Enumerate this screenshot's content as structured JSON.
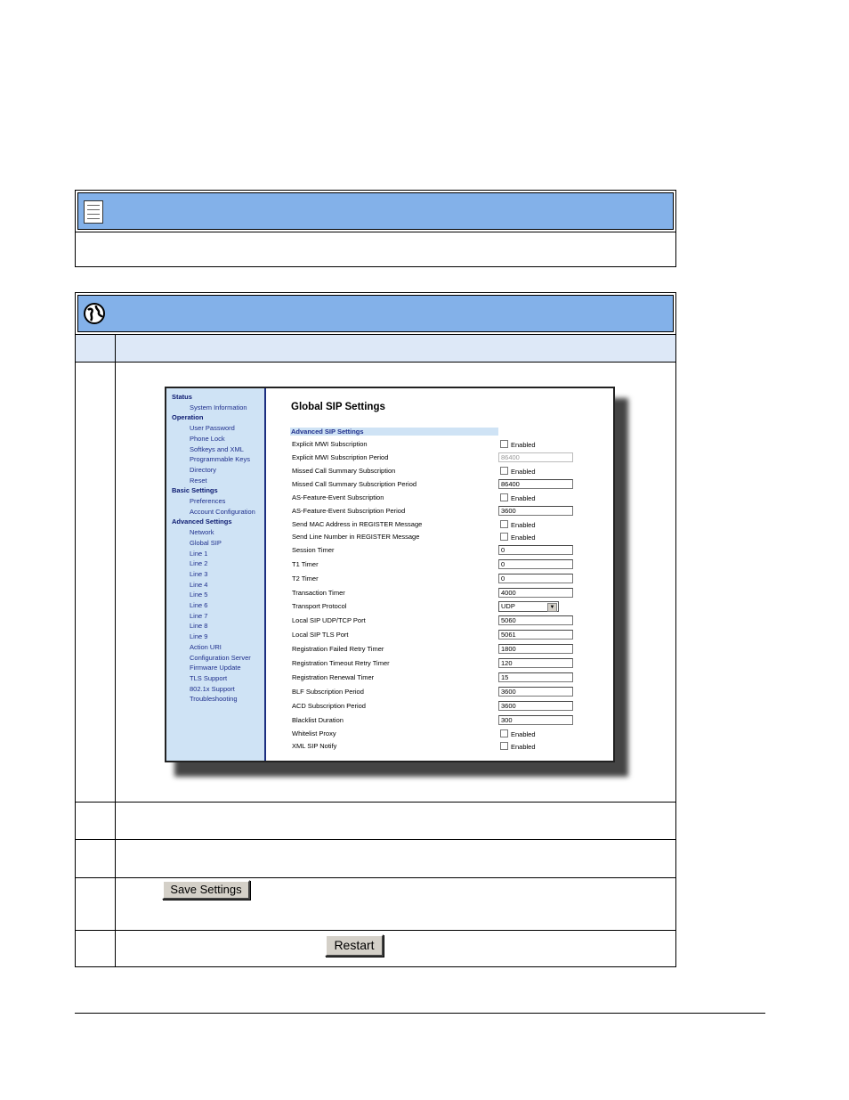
{
  "sidebar": {
    "sections": [
      {
        "label": "Status",
        "items": [
          "System Information"
        ]
      },
      {
        "label": "Operation",
        "items": [
          "User Password",
          "Phone Lock",
          "Softkeys and XML",
          "Programmable Keys",
          "Directory",
          "Reset"
        ]
      },
      {
        "label": "Basic Settings",
        "items": [
          "Preferences",
          "Account Configuration"
        ]
      },
      {
        "label": "Advanced Settings",
        "items": [
          "Network",
          "Global SIP",
          "Line 1",
          "Line 2",
          "Line 3",
          "Line 4",
          "Line 5",
          "Line 6",
          "Line 7",
          "Line 8",
          "Line 9",
          "Action URI",
          "Configuration Server",
          "Firmware Update",
          "TLS Support",
          "802.1x Support",
          "Troubleshooting"
        ]
      }
    ]
  },
  "page": {
    "title": "Global SIP Settings",
    "section_header": "Advanced SIP Settings",
    "enabled_label": "Enabled"
  },
  "fields": [
    {
      "label": "Explicit MWI Subscription",
      "type": "checkbox"
    },
    {
      "label": "Explicit MWI Subscription Period",
      "type": "text",
      "value": "86400",
      "disabled": true
    },
    {
      "label": "Missed Call Summary Subscription",
      "type": "checkbox"
    },
    {
      "label": "Missed Call Summary Subscription Period",
      "type": "text",
      "value": "86400"
    },
    {
      "label": "AS-Feature-Event Subscription",
      "type": "checkbox"
    },
    {
      "label": "AS-Feature-Event Subscription Period",
      "type": "text",
      "value": "3600"
    },
    {
      "label": "Send MAC Address in REGISTER Message",
      "type": "checkbox"
    },
    {
      "label": "Send Line Number in REGISTER Message",
      "type": "checkbox"
    },
    {
      "label": "Session Timer",
      "type": "text",
      "value": "0"
    },
    {
      "label": "T1 Timer",
      "type": "text",
      "value": "0"
    },
    {
      "label": "T2 Timer",
      "type": "text",
      "value": "0"
    },
    {
      "label": "Transaction Timer",
      "type": "text",
      "value": "4000"
    },
    {
      "label": "Transport Protocol",
      "type": "select",
      "value": "UDP"
    },
    {
      "label": "Local SIP UDP/TCP Port",
      "type": "text",
      "value": "5060"
    },
    {
      "label": "Local SIP TLS Port",
      "type": "text",
      "value": "5061"
    },
    {
      "label": "Registration Failed Retry Timer",
      "type": "text",
      "value": "1800"
    },
    {
      "label": "Registration Timeout Retry Timer",
      "type": "text",
      "value": "120"
    },
    {
      "label": "Registration Renewal Timer",
      "type": "text",
      "value": "15"
    },
    {
      "label": "BLF Subscription Period",
      "type": "text",
      "value": "3600"
    },
    {
      "label": "ACD Subscription Period",
      "type": "text",
      "value": "3600"
    },
    {
      "label": "Blacklist Duration",
      "type": "text",
      "value": "300"
    },
    {
      "label": "Whitelist Proxy",
      "type": "checkbox"
    },
    {
      "label": "XML SIP Notify",
      "type": "checkbox"
    }
  ],
  "buttons": {
    "save_settings": "Save Settings",
    "restart": "Restart"
  },
  "colors": {
    "header_bar": "#83b1e9",
    "table_header_row": "#dde8f7",
    "sidebar_bg": "#cfe3f5",
    "link": "#1f2f8c"
  }
}
